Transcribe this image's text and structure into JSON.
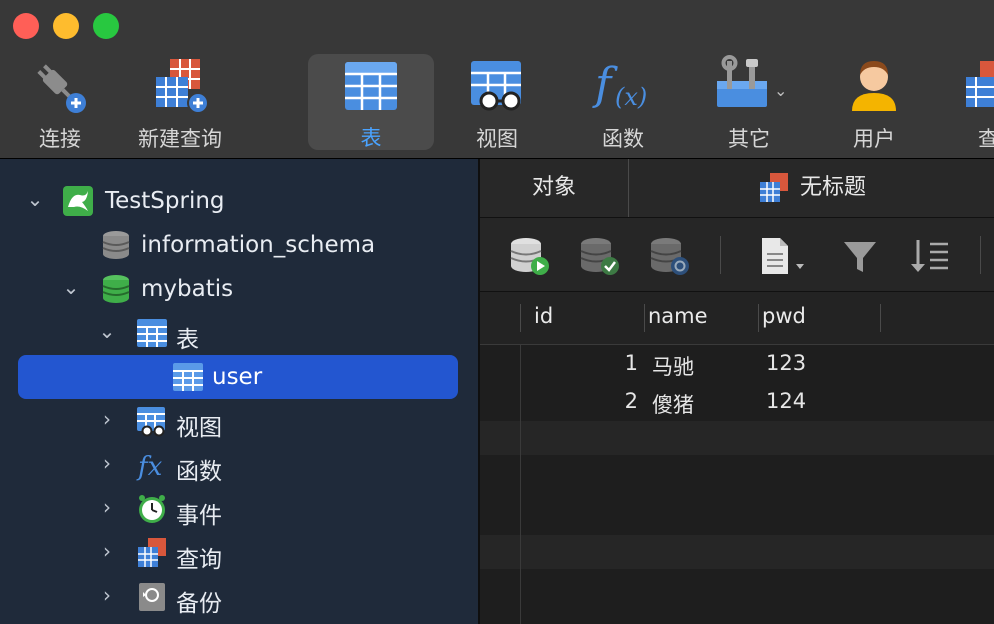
{
  "window": {
    "controls": [
      "close",
      "minimize",
      "zoom"
    ]
  },
  "toolbar": {
    "items": [
      {
        "label": "连接",
        "icon": "connect-plug-icon"
      },
      {
        "label": "新建查询",
        "icon": "new-query-icon"
      },
      {
        "label": "表",
        "icon": "table-icon",
        "active": true
      },
      {
        "label": "视图",
        "icon": "view-icon"
      },
      {
        "label": "函数",
        "icon": "function-icon"
      },
      {
        "label": "其它",
        "icon": "tools-icon"
      },
      {
        "label": "用户",
        "icon": "user-icon"
      },
      {
        "label": "查",
        "icon": "query-icon"
      }
    ]
  },
  "sidebar": {
    "connection": {
      "label": "TestSpring",
      "expanded": true
    },
    "databases": [
      {
        "label": "information_schema",
        "expanded": false
      },
      {
        "label": "mybatis",
        "expanded": true
      }
    ],
    "groups": [
      {
        "label": "表",
        "expanded": true
      },
      {
        "label": "视图"
      },
      {
        "label": "函数"
      },
      {
        "label": "事件"
      },
      {
        "label": "查询"
      },
      {
        "label": "备份"
      }
    ],
    "tables": [
      {
        "label": "user",
        "selected": true
      }
    ]
  },
  "tabs": {
    "objects_label": "对象",
    "untitled_label": "无标题"
  },
  "grid": {
    "columns": [
      "id",
      "name",
      "pwd"
    ],
    "rows": [
      {
        "id": "1",
        "name": "马驰",
        "pwd": "123"
      },
      {
        "id": "2",
        "name": "傻猪",
        "pwd": "124"
      }
    ]
  },
  "colors": {
    "accent": "#4aa3ff",
    "selection": "#2356d0",
    "sidebar_bg": "#1f2a3a",
    "db_green": "#3fae49"
  }
}
